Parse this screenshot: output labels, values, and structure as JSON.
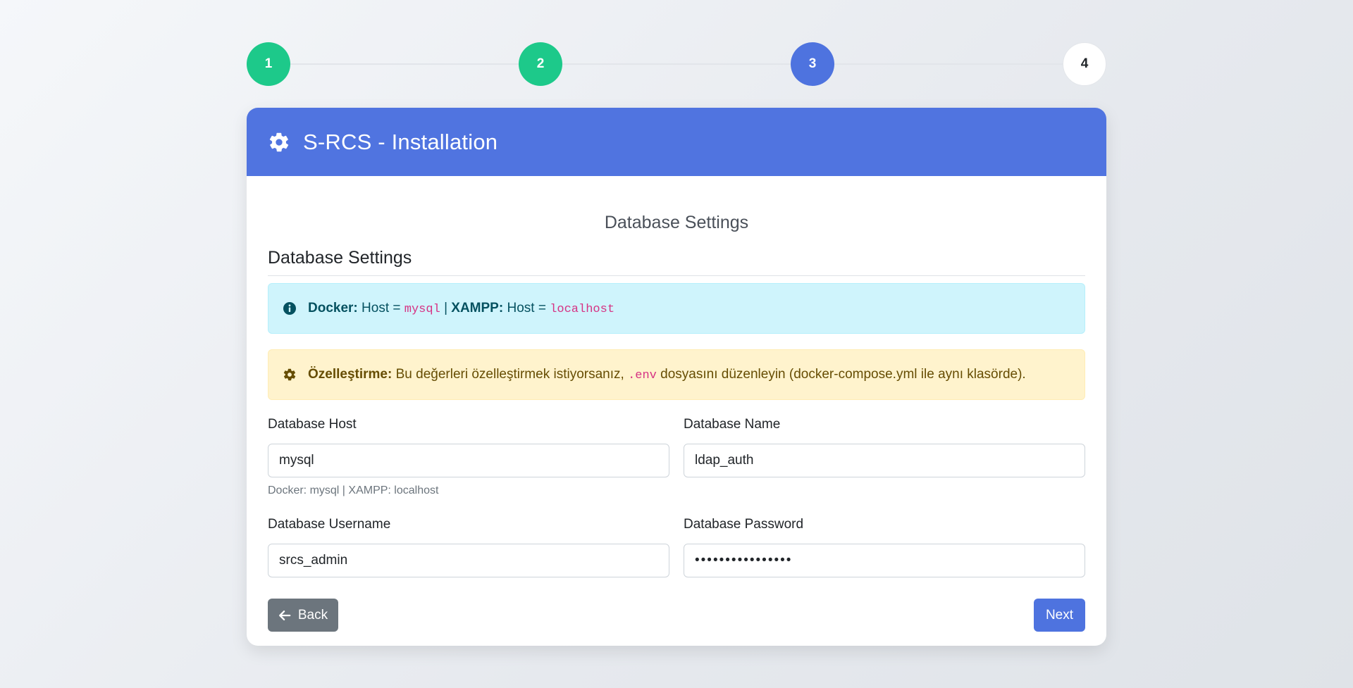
{
  "stepper": {
    "steps": [
      {
        "label": "1",
        "state": "done"
      },
      {
        "label": "2",
        "state": "done"
      },
      {
        "label": "3",
        "state": "active"
      },
      {
        "label": "4",
        "state": "todo"
      }
    ]
  },
  "header": {
    "icon": "gear-icon",
    "title": "S-RCS - Installation"
  },
  "page": {
    "subtitle": "Database Settings",
    "section_title": "Database Settings"
  },
  "alerts": {
    "info": {
      "icon": "info-circle-icon",
      "docker_label": "Docker:",
      "host_text_1": "Host =",
      "docker_host": "mysql",
      "separator": "|",
      "xampp_label": "XAMPP:",
      "host_text_2": "Host =",
      "xampp_host": "localhost"
    },
    "customize": {
      "icon": "gear-icon",
      "label": "Özelleştirme:",
      "text_before": "Bu değerleri özelleştirmek istiyorsanız,",
      "file": ".env",
      "text_after": "dosyasını düzenleyin (docker-compose.yml ile aynı klasörde)."
    }
  },
  "form": {
    "db_host": {
      "label": "Database Host",
      "value": "mysql",
      "help": "Docker: mysql | XAMPP: localhost"
    },
    "db_name": {
      "label": "Database Name",
      "value": "ldap_auth"
    },
    "db_user": {
      "label": "Database Username",
      "value": "srcs_admin"
    },
    "db_password": {
      "label": "Database Password",
      "value": "••••••••••••••••"
    }
  },
  "actions": {
    "back_label": "Back",
    "next_label": "Next"
  },
  "colors": {
    "primary": "#4e73df",
    "success": "#1dc98a",
    "secondary": "#6c757d"
  }
}
